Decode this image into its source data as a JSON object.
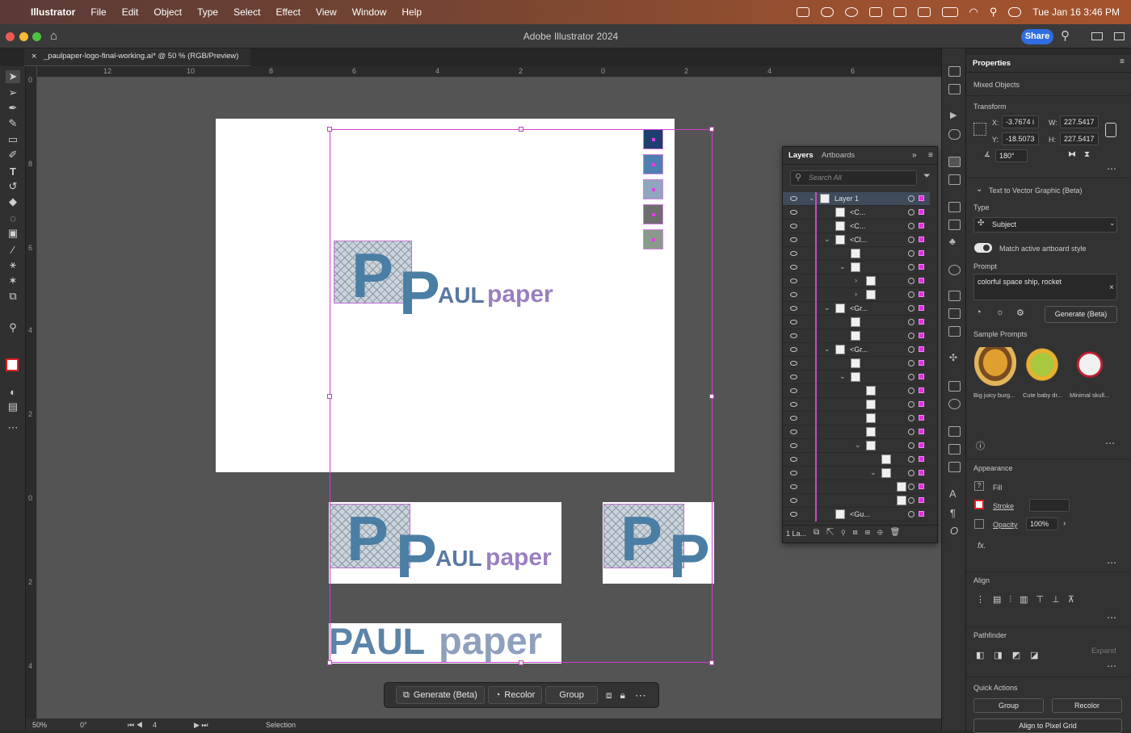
{
  "menubar": {
    "app": "Illustrator",
    "items": [
      "File",
      "Edit",
      "Object",
      "Type",
      "Select",
      "Effect",
      "View",
      "Window",
      "Help"
    ],
    "clock": "Tue Jan 16  3:46 PM"
  },
  "window": {
    "title": "Adobe Illustrator 2024",
    "share_label": "Share"
  },
  "document_tab": {
    "label": "_paulpaper-logo-final-working.ai* @ 50 % (RGB/Preview)"
  },
  "ruler": {
    "h_ticks": [
      "12",
      "10",
      "8",
      "6",
      "4",
      "2",
      "0",
      "2",
      "4",
      "6"
    ],
    "v_ticks": [
      "0",
      "8",
      "6",
      "4",
      "2",
      "0",
      "2",
      "4"
    ]
  },
  "artwork": {
    "logo_p": "P",
    "logo_aul": "AUL",
    "logo_paper": "paper",
    "wordmark_paul": "PAUL",
    "wordmark_paper": "paper",
    "swatch_colors": [
      "#1f3f6e",
      "#4f7fb0",
      "#8fa6be",
      "#6e6e6e",
      "#8a9a8a"
    ]
  },
  "context_bar": {
    "generate": "Generate (Beta)",
    "recolor": "Recolor",
    "group": "Group"
  },
  "statusbar": {
    "zoom": "50%",
    "rotation": "0°",
    "artboard": "4",
    "tool": "Selection"
  },
  "layers_panel": {
    "tab_layers": "Layers",
    "tab_artboards": "Artboards",
    "search_placeholder": "Search All",
    "footer_count": "1 La...",
    "rows": [
      {
        "label": "Layer 1",
        "indent": 0,
        "chev": "⌄"
      },
      {
        "label": "<C...",
        "indent": 1,
        "chev": ""
      },
      {
        "label": "<C...",
        "indent": 1,
        "chev": ""
      },
      {
        "label": "<Cl...",
        "indent": 1,
        "chev": "⌄"
      },
      {
        "label": "",
        "indent": 2,
        "chev": ""
      },
      {
        "label": "",
        "indent": 2,
        "chev": "⌄"
      },
      {
        "label": "",
        "indent": 3,
        "chev": "›"
      },
      {
        "label": "",
        "indent": 3,
        "chev": "›"
      },
      {
        "label": "<Gr...",
        "indent": 1,
        "chev": "⌄"
      },
      {
        "label": "",
        "indent": 2,
        "chev": ""
      },
      {
        "label": "",
        "indent": 2,
        "chev": ""
      },
      {
        "label": "<Gr...",
        "indent": 1,
        "chev": "⌄"
      },
      {
        "label": "",
        "indent": 2,
        "chev": ""
      },
      {
        "label": "",
        "indent": 2,
        "chev": "⌄"
      },
      {
        "label": "",
        "indent": 3,
        "chev": ""
      },
      {
        "label": "",
        "indent": 3,
        "chev": ""
      },
      {
        "label": "",
        "indent": 3,
        "chev": ""
      },
      {
        "label": "",
        "indent": 3,
        "chev": ""
      },
      {
        "label": "",
        "indent": 3,
        "chev": "⌄"
      },
      {
        "label": "",
        "indent": 4,
        "chev": ""
      },
      {
        "label": "",
        "indent": 4,
        "chev": "⌄"
      },
      {
        "label": "",
        "indent": 5,
        "chev": ""
      },
      {
        "label": "",
        "indent": 5,
        "chev": ""
      },
      {
        "label": "<Gu...",
        "indent": 1,
        "chev": ""
      }
    ]
  },
  "properties": {
    "title": "Properties",
    "selection": "Mixed Objects",
    "transform": {
      "heading": "Transform",
      "x_label": "X:",
      "x": "-3.7674 i",
      "y_label": "Y:",
      "y": "-18.5073",
      "w_label": "W:",
      "w": "227.5417",
      "h_label": "H:",
      "h": "227.5417",
      "angle": "180°"
    },
    "t2v": {
      "heading": "Text to Vector Graphic (Beta)",
      "type_label": "Type",
      "type_value": "Subject",
      "match_label": "Match active artboard style",
      "prompt_label": "Prompt",
      "prompt_value": "colorful space ship, rocket",
      "generate": "Generate (Beta)",
      "samples_label": "Sample Prompts",
      "samples": [
        "Big juicy burg...",
        "Cute baby dr...",
        "Minimal skull..."
      ]
    },
    "appearance": {
      "heading": "Appearance",
      "fill": "Fill",
      "stroke": "Stroke",
      "opacity_label": "Opacity",
      "opacity": "100%",
      "fx": "fx."
    },
    "align": {
      "heading": "Align"
    },
    "pathfinder": {
      "heading": "Pathfinder",
      "expand": "Expand"
    },
    "quick_actions": {
      "heading": "Quick Actions",
      "group": "Group",
      "recolor": "Recolor",
      "align_pixel": "Align to Pixel Grid"
    }
  }
}
